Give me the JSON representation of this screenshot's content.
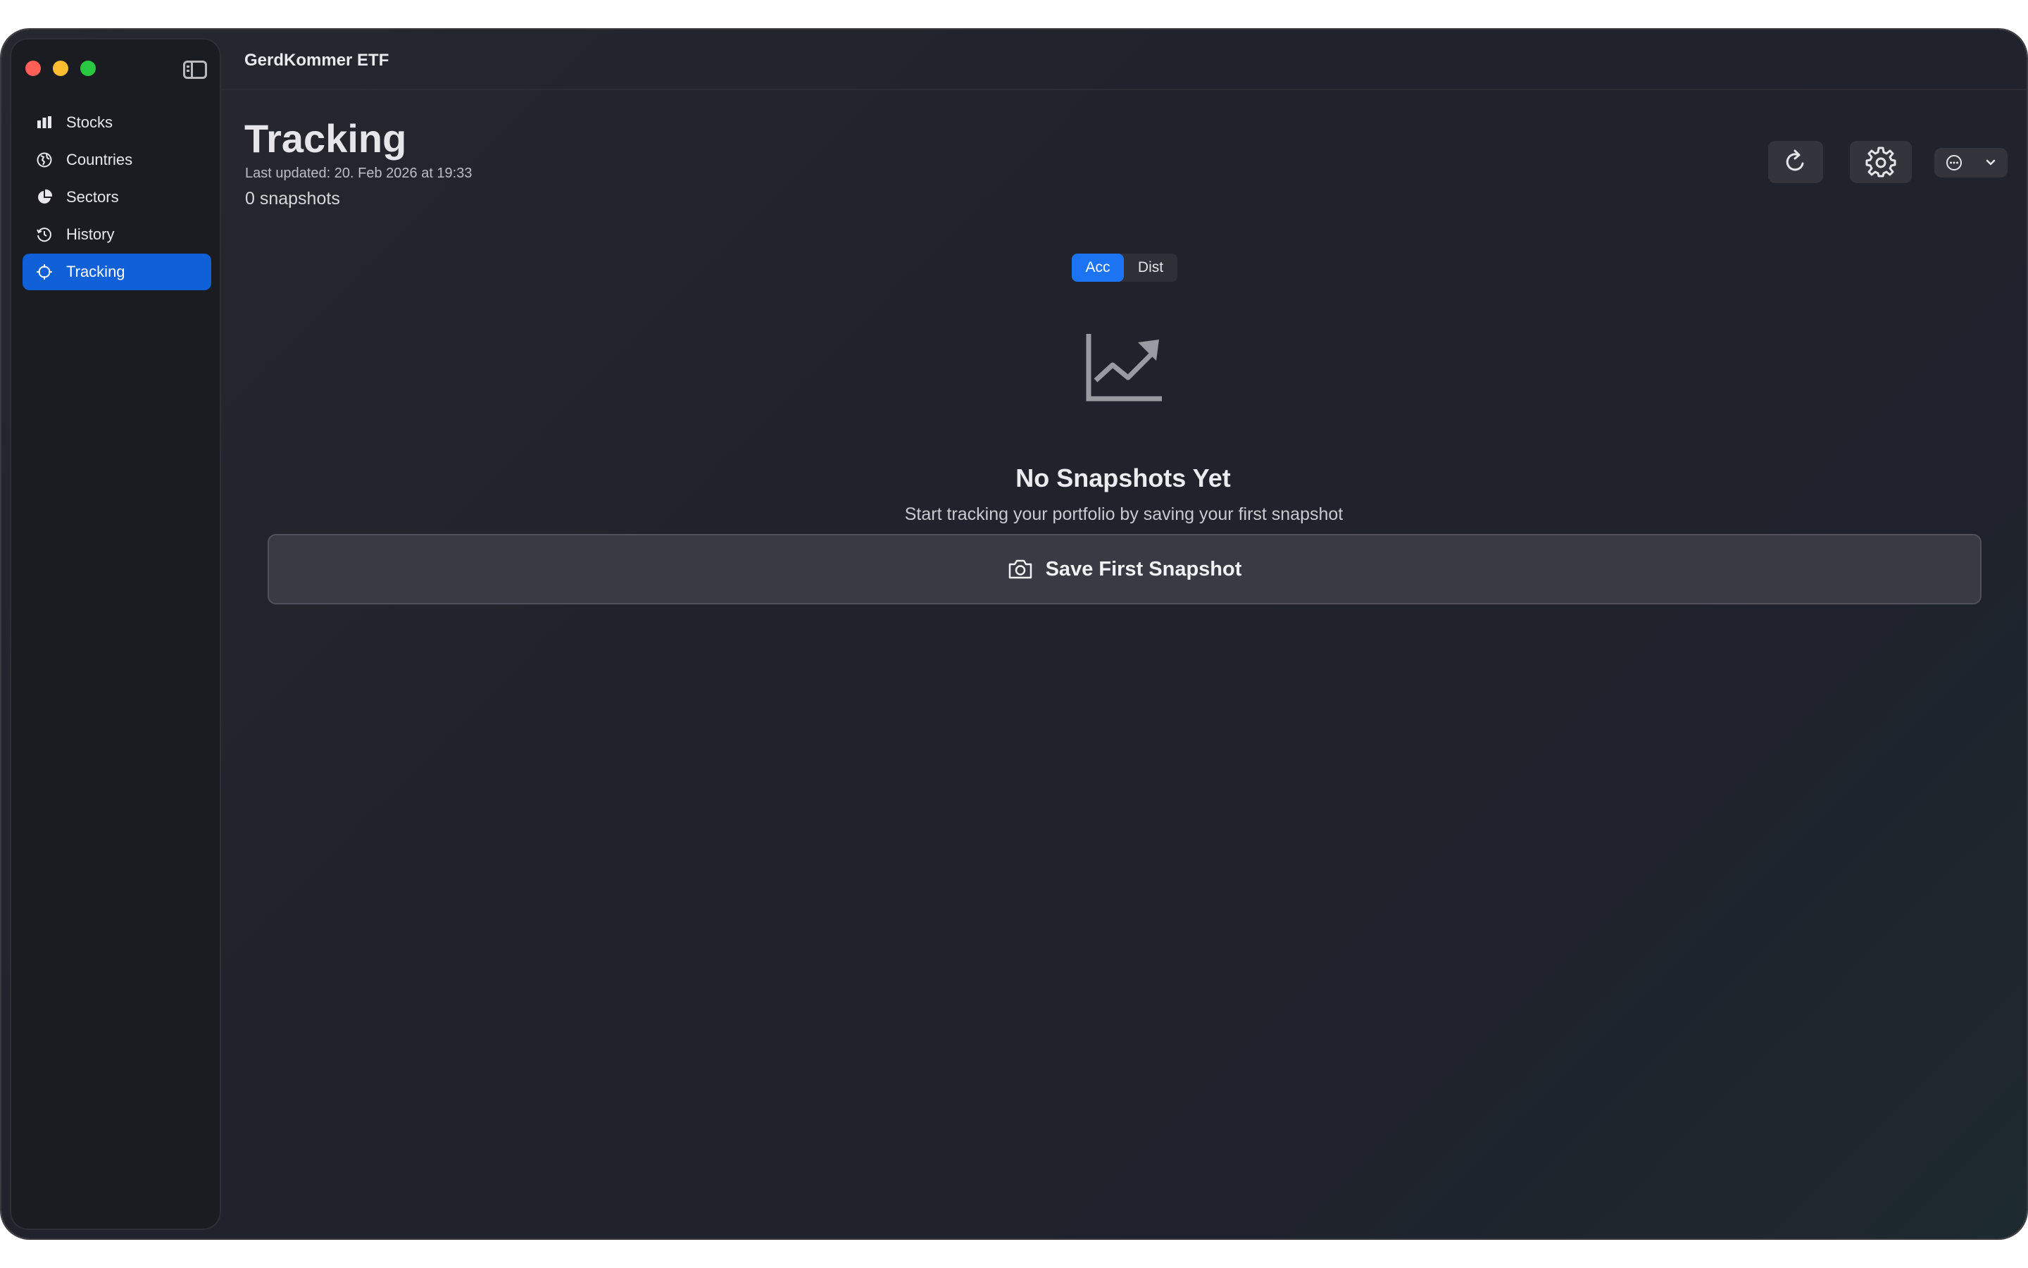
{
  "window": {
    "title": "GerdKommer ETF"
  },
  "sidebar": {
    "items": [
      {
        "label": "Stocks",
        "icon": "bar-chart-icon",
        "active": false
      },
      {
        "label": "Countries",
        "icon": "globe-icon",
        "active": false
      },
      {
        "label": "Sectors",
        "icon": "pie-chart-icon",
        "active": false
      },
      {
        "label": "History",
        "icon": "clock-history-icon",
        "active": false
      },
      {
        "label": "Tracking",
        "icon": "target-icon",
        "active": true
      }
    ]
  },
  "header": {
    "title": "Tracking",
    "last_updated": "Last updated: 20. Feb 2026 at 19:33",
    "snapshot_count": "0 snapshots"
  },
  "toolbar": {
    "refresh_icon": "refresh-icon",
    "settings_icon": "gear-icon",
    "more_icon": "ellipsis-circle-icon",
    "more_chevron": "chevron-down-icon"
  },
  "segmented": {
    "options": [
      "Acc",
      "Dist"
    ],
    "selected": "Acc"
  },
  "empty_state": {
    "icon": "chart-line-uptrend-icon",
    "title": "No Snapshots Yet",
    "subtitle": "Start tracking your portfolio by saving your first snapshot",
    "button_label": "Save First Snapshot",
    "button_icon": "camera-icon"
  },
  "colors": {
    "accent": "#1060d8",
    "segment_selected": "#1d74f2",
    "traffic_red": "#ff5f57",
    "traffic_yellow": "#febc2e",
    "traffic_green": "#28c840"
  }
}
